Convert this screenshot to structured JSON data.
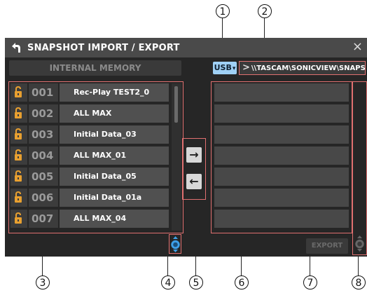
{
  "window": {
    "title": "SNAPSHOT IMPORT / EXPORT",
    "close_glyph": "×"
  },
  "internal_memory_label": "INTERNAL MEMORY",
  "usb": {
    "label": "USB",
    "arrow": "▾"
  },
  "path": {
    "text": "\\\\TASCAM\\SONICVIEW\\SNAPSHOT\\"
  },
  "snapshots": [
    {
      "number": "001",
      "name": "Rec-Play TEST2_0"
    },
    {
      "number": "002",
      "name": "ALL MAX"
    },
    {
      "number": "003",
      "name": "Initial Data_03"
    },
    {
      "number": "004",
      "name": "ALL MAX_01"
    },
    {
      "number": "005",
      "name": "Initial Data_05"
    },
    {
      "number": "006",
      "name": "Initial Data_01a"
    },
    {
      "number": "007",
      "name": "ALL MAX_04"
    }
  ],
  "transfer": {
    "export_arrow": "→",
    "import_arrow": "←"
  },
  "export_label": "EXPORT",
  "callouts": [
    "1",
    "2",
    "3",
    "4",
    "5",
    "6",
    "7",
    "8"
  ],
  "colors": {
    "window_bg": "#262626",
    "titlebar": "#4a4a4a",
    "highlight": "#e07070",
    "usb_button": "#9fd0f5",
    "lock_icon": "#e8a030",
    "scroll_knob": "#3da0e8"
  },
  "icons": [
    "back-icon",
    "close-icon",
    "lock-icon",
    "right-arrow-icon",
    "left-arrow-icon",
    "scroll-knob-icon"
  ]
}
